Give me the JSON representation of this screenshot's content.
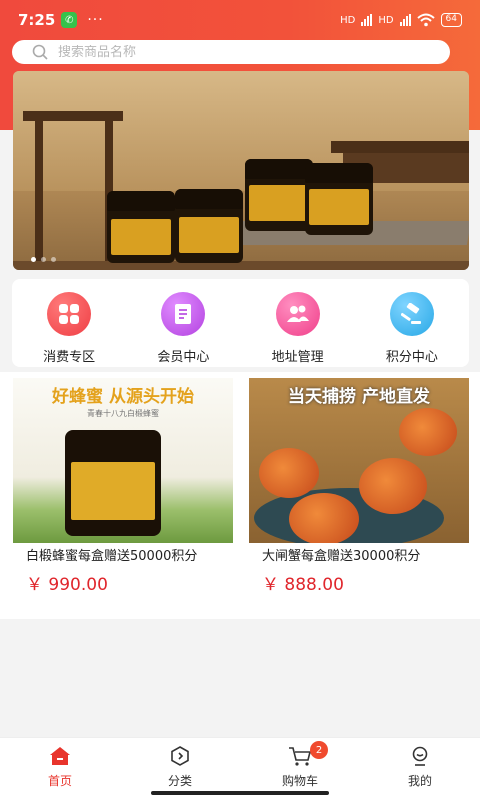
{
  "status_bar": {
    "time": "7:25",
    "dots": "···",
    "network_1": "HD",
    "network_2": "HD",
    "battery": "64"
  },
  "search": {
    "placeholder": "搜索商品名称"
  },
  "banner": {
    "slide_count": 3,
    "active_slide": 1
  },
  "nav": {
    "items": [
      {
        "label": "消费专区",
        "icon": "grid-icon",
        "color": "#ef3e44"
      },
      {
        "label": "会员中心",
        "icon": "document-icon",
        "color": "#b342e0"
      },
      {
        "label": "地址管理",
        "icon": "users-icon",
        "color": "#f03f8a"
      },
      {
        "label": "积分中心",
        "icon": "gavel-icon",
        "color": "#28a8e6"
      }
    ]
  },
  "products": [
    {
      "image_headline": "好蜂蜜 从源头开始",
      "image_sub": "青春十八九白椴蜂蜜",
      "name": "白椴蜂蜜每盒赠送50000积分",
      "price": "￥ 990.00"
    },
    {
      "image_headline": "当天捕捞 产地直发",
      "name": "大闸蟹每盒赠送30000积分",
      "price": "￥ 888.00"
    }
  ],
  "bottom_nav": {
    "tabs": [
      {
        "label": "首页",
        "icon": "home-icon",
        "active": true
      },
      {
        "label": "分类",
        "icon": "category-icon",
        "active": false
      },
      {
        "label": "购物车",
        "icon": "cart-icon",
        "active": false,
        "badge": "2"
      },
      {
        "label": "我的",
        "icon": "profile-icon",
        "active": false
      }
    ]
  },
  "colors": {
    "header_red": "#f04a3d",
    "price_red": "#e0262c",
    "active_tab": "#e8342c"
  }
}
